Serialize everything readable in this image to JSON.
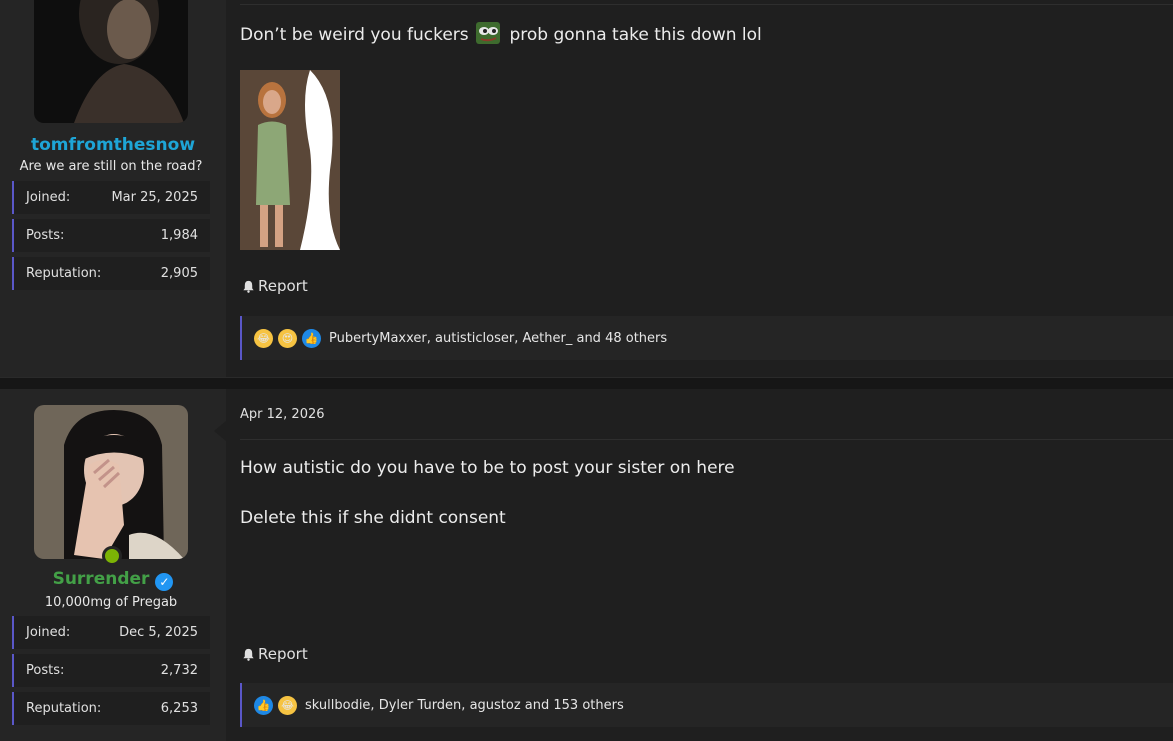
{
  "posts": [
    {
      "username": "tomfromthesnow",
      "user_title": "Are we are still on the road?",
      "stats": [
        {
          "label": "Joined:",
          "value": "Mar 25, 2025"
        },
        {
          "label": "Posts:",
          "value": "1,984"
        },
        {
          "label": "Reputation:",
          "value": "2,905"
        }
      ],
      "body_before_emoji": "Don’t be weird you fuckers",
      "emoji": "pepe-icon",
      "body_after_emoji": "prob gonna take this down lol",
      "report_label": "Report",
      "reactions_text": "PubertyMaxxer, autisticloser, Aether_ and 48 others",
      "reaction_icons": [
        "laughing-emoji-icon",
        "heart-eyes-emoji-icon",
        "thumbs-up-icon"
      ]
    },
    {
      "date": "Apr 12, 2026",
      "username": "Surrender",
      "user_title": "10,000mg of Pregab",
      "stats": [
        {
          "label": "Joined:",
          "value": "Dec 5, 2025"
        },
        {
          "label": "Posts:",
          "value": "2,732"
        },
        {
          "label": "Reputation:",
          "value": "6,253"
        }
      ],
      "body_line1": "How autistic do you have to be to post your sister on here",
      "body_line2": "Delete this if she didnt consent",
      "report_label": "Report",
      "reactions_text": "skullbodie, Dyler Turden, agustoz and 153 others",
      "reaction_icons": [
        "thumbs-up-icon",
        "laughing-emoji-icon"
      ]
    }
  ],
  "colors": {
    "username_1": "#1ea5d6",
    "username_2": "#43a047",
    "accent_border": "#5a57c8",
    "online": "#7cb305"
  }
}
